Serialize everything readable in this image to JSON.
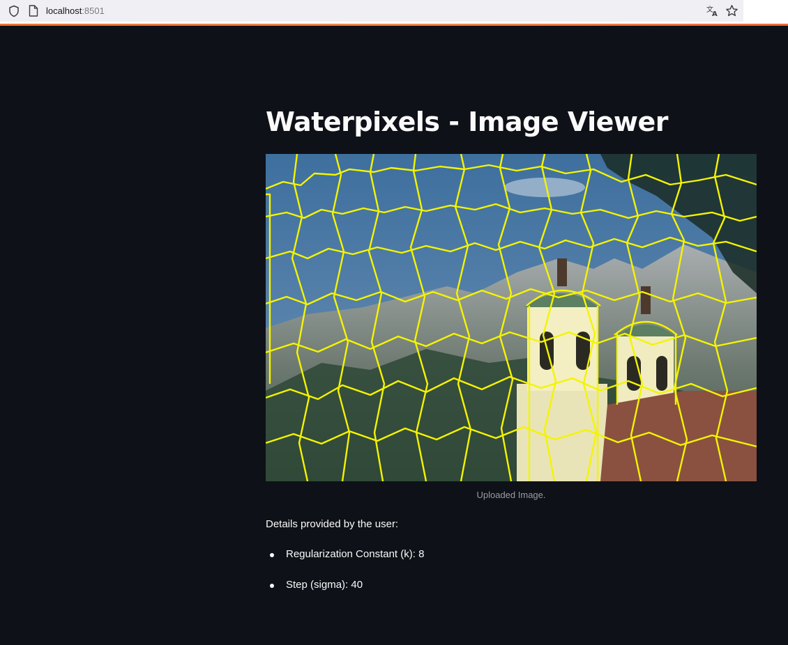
{
  "browser": {
    "url_host": "localhost",
    "url_port": ":8501",
    "icons": {
      "shield": "shield-icon",
      "page": "page-icon",
      "translate": "translate-icon",
      "bookmark": "star-icon"
    },
    "accent_color": "#ec6b3a"
  },
  "app": {
    "background_color": "#0e1117",
    "title": "Waterpixels - Image Viewer",
    "image": {
      "description_tag": "waterpixel-segmented-photo",
      "boundary_color": "#f4f400",
      "caption": "Uploaded Image."
    },
    "details_heading": "Details provided by the user:",
    "details": [
      {
        "text": "Regularization Constant (k): 8"
      },
      {
        "text": "Step (sigma): 40"
      }
    ]
  }
}
